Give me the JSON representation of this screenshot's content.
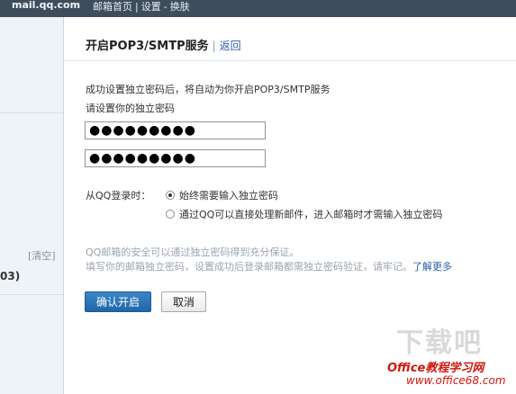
{
  "topbar": {
    "domain": "mail.qq.com",
    "nav": [
      "邮箱首页",
      "设置",
      "换肤"
    ]
  },
  "sidebar": {
    "clear_label": "[清空]",
    "partial_label": "03)"
  },
  "page": {
    "title": "开启POP3/SMTP服务",
    "back_label": "返回",
    "intro": "成功设置独立密码后，将自动为你开启POP3/SMTP服务",
    "prompt": "请设置你的独立密码",
    "password_value": "●●●●●●●●●",
    "confirm_value": "●●●●●●●●●",
    "login_label": "从QQ登录时：",
    "options": [
      {
        "label": "始终需要输入独立密码",
        "selected": true
      },
      {
        "label": "通过QQ可以直接处理新邮件，进入邮箱时才需输入独立密码",
        "selected": false
      }
    ],
    "note1": "QQ邮箱的安全可以通过独立密码得到充分保证。",
    "note2": "填写你的邮箱独立密码，设置成功后登录邮箱都需独立密码验证，请牢记。",
    "learn_more": "了解更多",
    "confirm_button": "确认开启",
    "cancel_button": "取消"
  },
  "watermark": {
    "big": "下载吧",
    "brand": "Office教程学习网",
    "url": "www.office68.com"
  },
  "colors": {
    "topbar": "#3e4d5c",
    "sidebar": "#eef3f8",
    "link": "#2a5fa9",
    "primary_button": "#2a72b5",
    "watermark_red": "#d0170f"
  }
}
